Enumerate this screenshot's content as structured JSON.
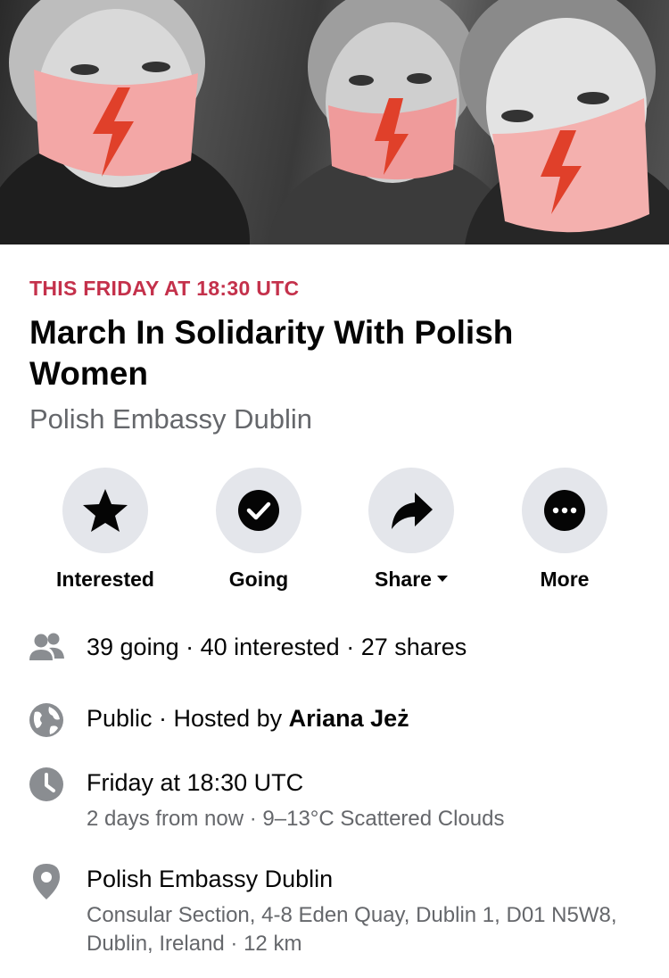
{
  "event": {
    "when": "THIS FRIDAY AT 18:30 UTC",
    "title": "March In Solidarity With Polish Women",
    "host_page": "Polish Embassy Dublin"
  },
  "actions": [
    {
      "label": "Interested",
      "icon": "star-icon"
    },
    {
      "label": "Going",
      "icon": "check-circle-icon"
    },
    {
      "label": "Share",
      "icon": "share-arrow-icon"
    },
    {
      "label": "More",
      "icon": "more-dots-icon"
    }
  ],
  "details": {
    "stats": "39 going · 40 interested · 27 shares",
    "privacy": "Public",
    "hosted_by_prefix": " · Hosted by ",
    "host": "Ariana Jeż",
    "time": "Friday at 18:30 UTC",
    "time_sub": "2 days from now · 9–13°C Scattered Clouds",
    "location": "Polish Embassy Dublin",
    "address": "Consular Section, 4-8 Eden Quay, Dublin 1, D01 N5W8, Dublin, Ireland · 12 km"
  },
  "colors": {
    "accent": "#c4314b",
    "secondary_text": "#65676b",
    "button_bg": "#e4e6eb",
    "mask": "#f3a7a6",
    "bolt": "#e0402a"
  }
}
